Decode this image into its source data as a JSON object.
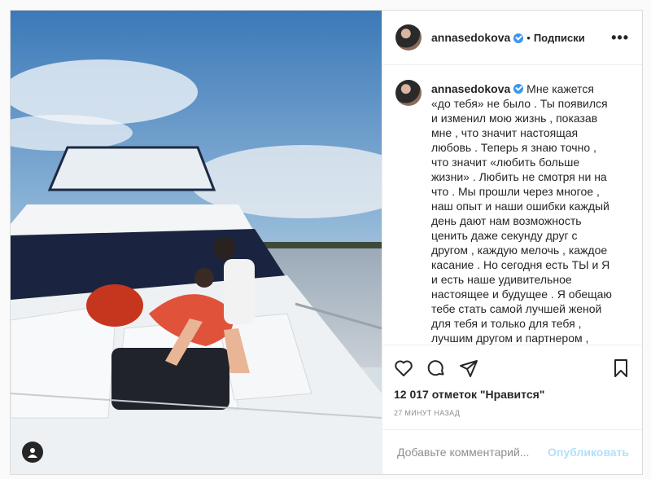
{
  "post": {
    "username": "annasedokova",
    "follow_label": "Подписки",
    "more_label": "•••",
    "separator": "•",
    "caption": "Мне кажется «до тебя» не было . Ты появился и изменил мою жизнь , показав мне , что значит настоящая любовь . Теперь я знаю точно , что значит «любить больше жизни» . Любить не смотря ни на что . Мы прошли через многое , наш опыт и наши ошибки каждый день дают нам возможность ценить даже секунду друг с другом , каждую мелочь , каждое касание . Но сегодня есть ТЫ и Я и есть наше удивительное настоящее и будущее . Я обещаю тебе стать самой лучшей женой для тебя и только для тебя , лучшим другом и партнером , лучшей мамой нашим детям . Я благодарю Бога за каждую секунду с тобой и скучаю каждую секунду без тебя",
    "likes": "12 017 отметок \"Нравится\"",
    "time": "27 МИНУТ НАЗАД",
    "comment_placeholder": "Добавьте комментарий...",
    "publish_label": "Опубликовать"
  },
  "icons": [
    "heart-icon",
    "comment-icon",
    "share-icon",
    "bookmark-icon",
    "user-tag-icon",
    "verified-icon"
  ],
  "colors": {
    "verified": "#3897f0",
    "publish": "#b2dffc",
    "meta": "#8e8e8e"
  }
}
